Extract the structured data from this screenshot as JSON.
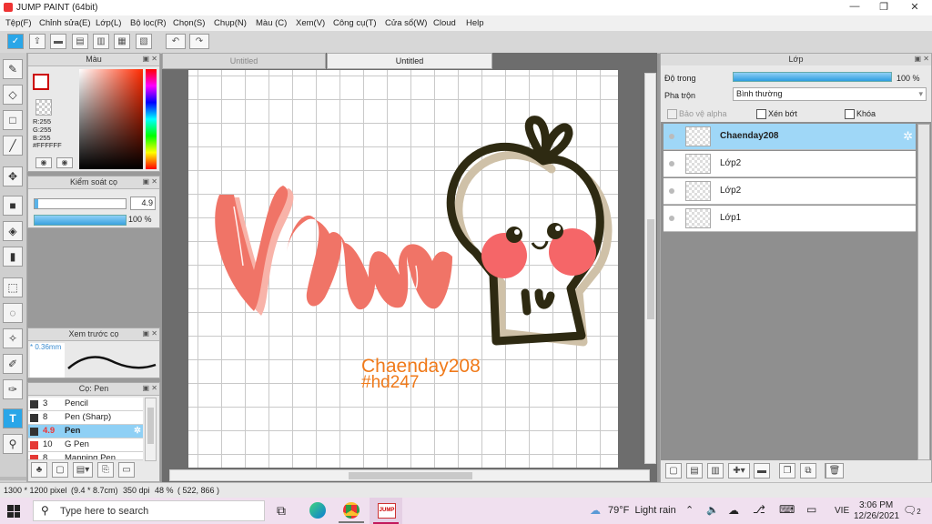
{
  "window": {
    "title": "JUMP PAINT (64bit)"
  },
  "menu": [
    "Tệp(F)",
    "Chỉnh sửa(E)",
    "Lớp(L)",
    "Bộ lọc(R)",
    "Chọn(S)",
    "Chụp(N)",
    "Màu (C)",
    "Xem(V)",
    "Công cụ(T)",
    "Cửa sổ(W)",
    "Cloud",
    "Help"
  ],
  "tabs": [
    "Untitled",
    "Untitled"
  ],
  "color_panel": {
    "title": "Màu",
    "r": "R:255",
    "g": "G:255",
    "b": "B:255",
    "hex": "#FFFFFF"
  },
  "brush_control": {
    "title": "Kiểm soát cọ",
    "size": "4.9",
    "opacity": "100 %"
  },
  "preview": {
    "title": "Xem trước cọ",
    "size": "* 0.36mm"
  },
  "brush_list": {
    "title": "Cọ: Pen",
    "items": [
      {
        "size": "3",
        "name": "Pencil",
        "color": "#333333"
      },
      {
        "size": "8",
        "name": "Pen (Sharp)",
        "color": "#333333"
      },
      {
        "size": "4.9",
        "name": "Pen",
        "color": "#333333"
      },
      {
        "size": "10",
        "name": "G Pen",
        "color": "#e53935"
      },
      {
        "size": "8",
        "name": "Mapping Pen",
        "color": "#e53935"
      }
    ]
  },
  "layer_panel": {
    "title": "Lớp",
    "opacity_label": "Độ trong",
    "opacity_value": "100 %",
    "blend_label": "Pha trộn",
    "blend_value": "Bình thường",
    "protect_alpha": "Bảo vệ alpha",
    "clip": "Xén bớt",
    "lock": "Khóa",
    "layers": [
      "Chaenday208",
      "Lớp2",
      "Lớp2",
      "Lớp1"
    ]
  },
  "canvas": {
    "text_line1": "Chaenday208",
    "text_line2": "#hd247",
    "script_text": "Vvvu"
  },
  "status": {
    "dims": "1300 * 1200 pixel",
    "size_cm": "(9.4 * 8.7cm)",
    "dpi": "350 dpi",
    "zoom": "48 %",
    "coords": "( 522, 866 )"
  },
  "taskbar": {
    "search_placeholder": "Type here to search",
    "weather": "79°F  Light rain",
    "lang": "VIE",
    "time": "3:06 PM",
    "date": "12/26/2021",
    "notif": "2"
  },
  "colors": {
    "accent": "#29a6e8",
    "pink": "#f07467",
    "skull": "#2e2a12"
  }
}
